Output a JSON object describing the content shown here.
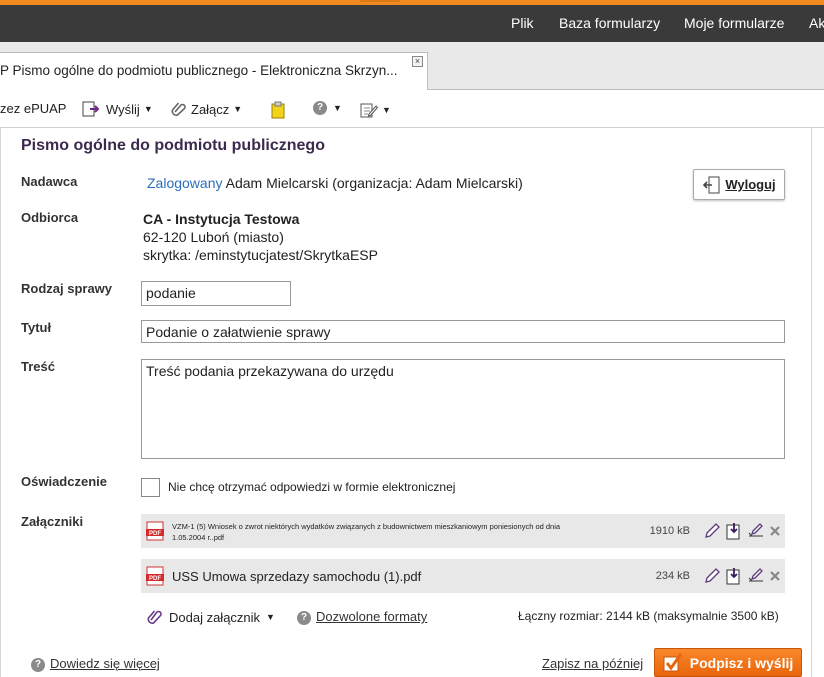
{
  "menubar": {
    "items": [
      "Plik",
      "Baza formularzy",
      "Moje formularze",
      "Ak"
    ]
  },
  "tab": {
    "title": "P Pismo ogólne do podmiotu publicznego - Elektroniczna Skrzyn...",
    "close": "×"
  },
  "toolbar": {
    "epuap": "zez ePUAP",
    "send": "Wyślij",
    "attach": "Załącz"
  },
  "form": {
    "heading": "Pismo ogólne do podmiotu publicznego",
    "sender_label": "Nadawca",
    "sender_link": "Zalogowany",
    "sender_text": "Adam Mielcarski (organizacja: Adam Mielcarski)",
    "logout": "Wyloguj",
    "recipient_label": "Odbiorca",
    "recipient_name": "CA - Instytucja Testowa",
    "recipient_city": "62-120 Luboń (miasto)",
    "recipient_box": "skrytka: /eminstytucjatest/SkrytkaESP",
    "case_type_label": "Rodzaj sprawy",
    "case_type_value": "podanie",
    "title_label": "Tytuł",
    "title_value": "Podanie o załatwienie sprawy",
    "content_label": "Treść",
    "content_value": "Treść podania przekazywana do urzędu",
    "declaration_label": "Oświadczenie",
    "declaration_text": "Nie chcę otrzymać odpowiedzi w formie elektronicznej",
    "attachments_label": "Załączniki"
  },
  "attachments": [
    {
      "name_line1": "VZM-1 (5) Wniosek o zwrot niektórych wydatków związanych z budownictwem mieszkaniowym poniesionych od dnia",
      "name_line2": "1.05.2004 r..pdf",
      "size": "1910 kB"
    },
    {
      "name": "USS Umowa sprzedazy samochodu (1).pdf",
      "size": "234 kB"
    }
  ],
  "attachments_footer": {
    "add": "Dodaj załącznik",
    "formats": "Dozwolone formaty",
    "total": "Łączny rozmiar: 2144 kB (maksymalnie 3500 kB)"
  },
  "footer": {
    "learn_more": "Dowiedz się więcej",
    "save_later": "Zapisz na później",
    "sign_send": "Podpisz i wyślij"
  },
  "icons": {
    "pdf": "pdf-icon",
    "help": "?"
  },
  "colors": {
    "accent": "#f08a1e",
    "link": "#2a6ebb",
    "menubar": "#3a3a3a"
  }
}
